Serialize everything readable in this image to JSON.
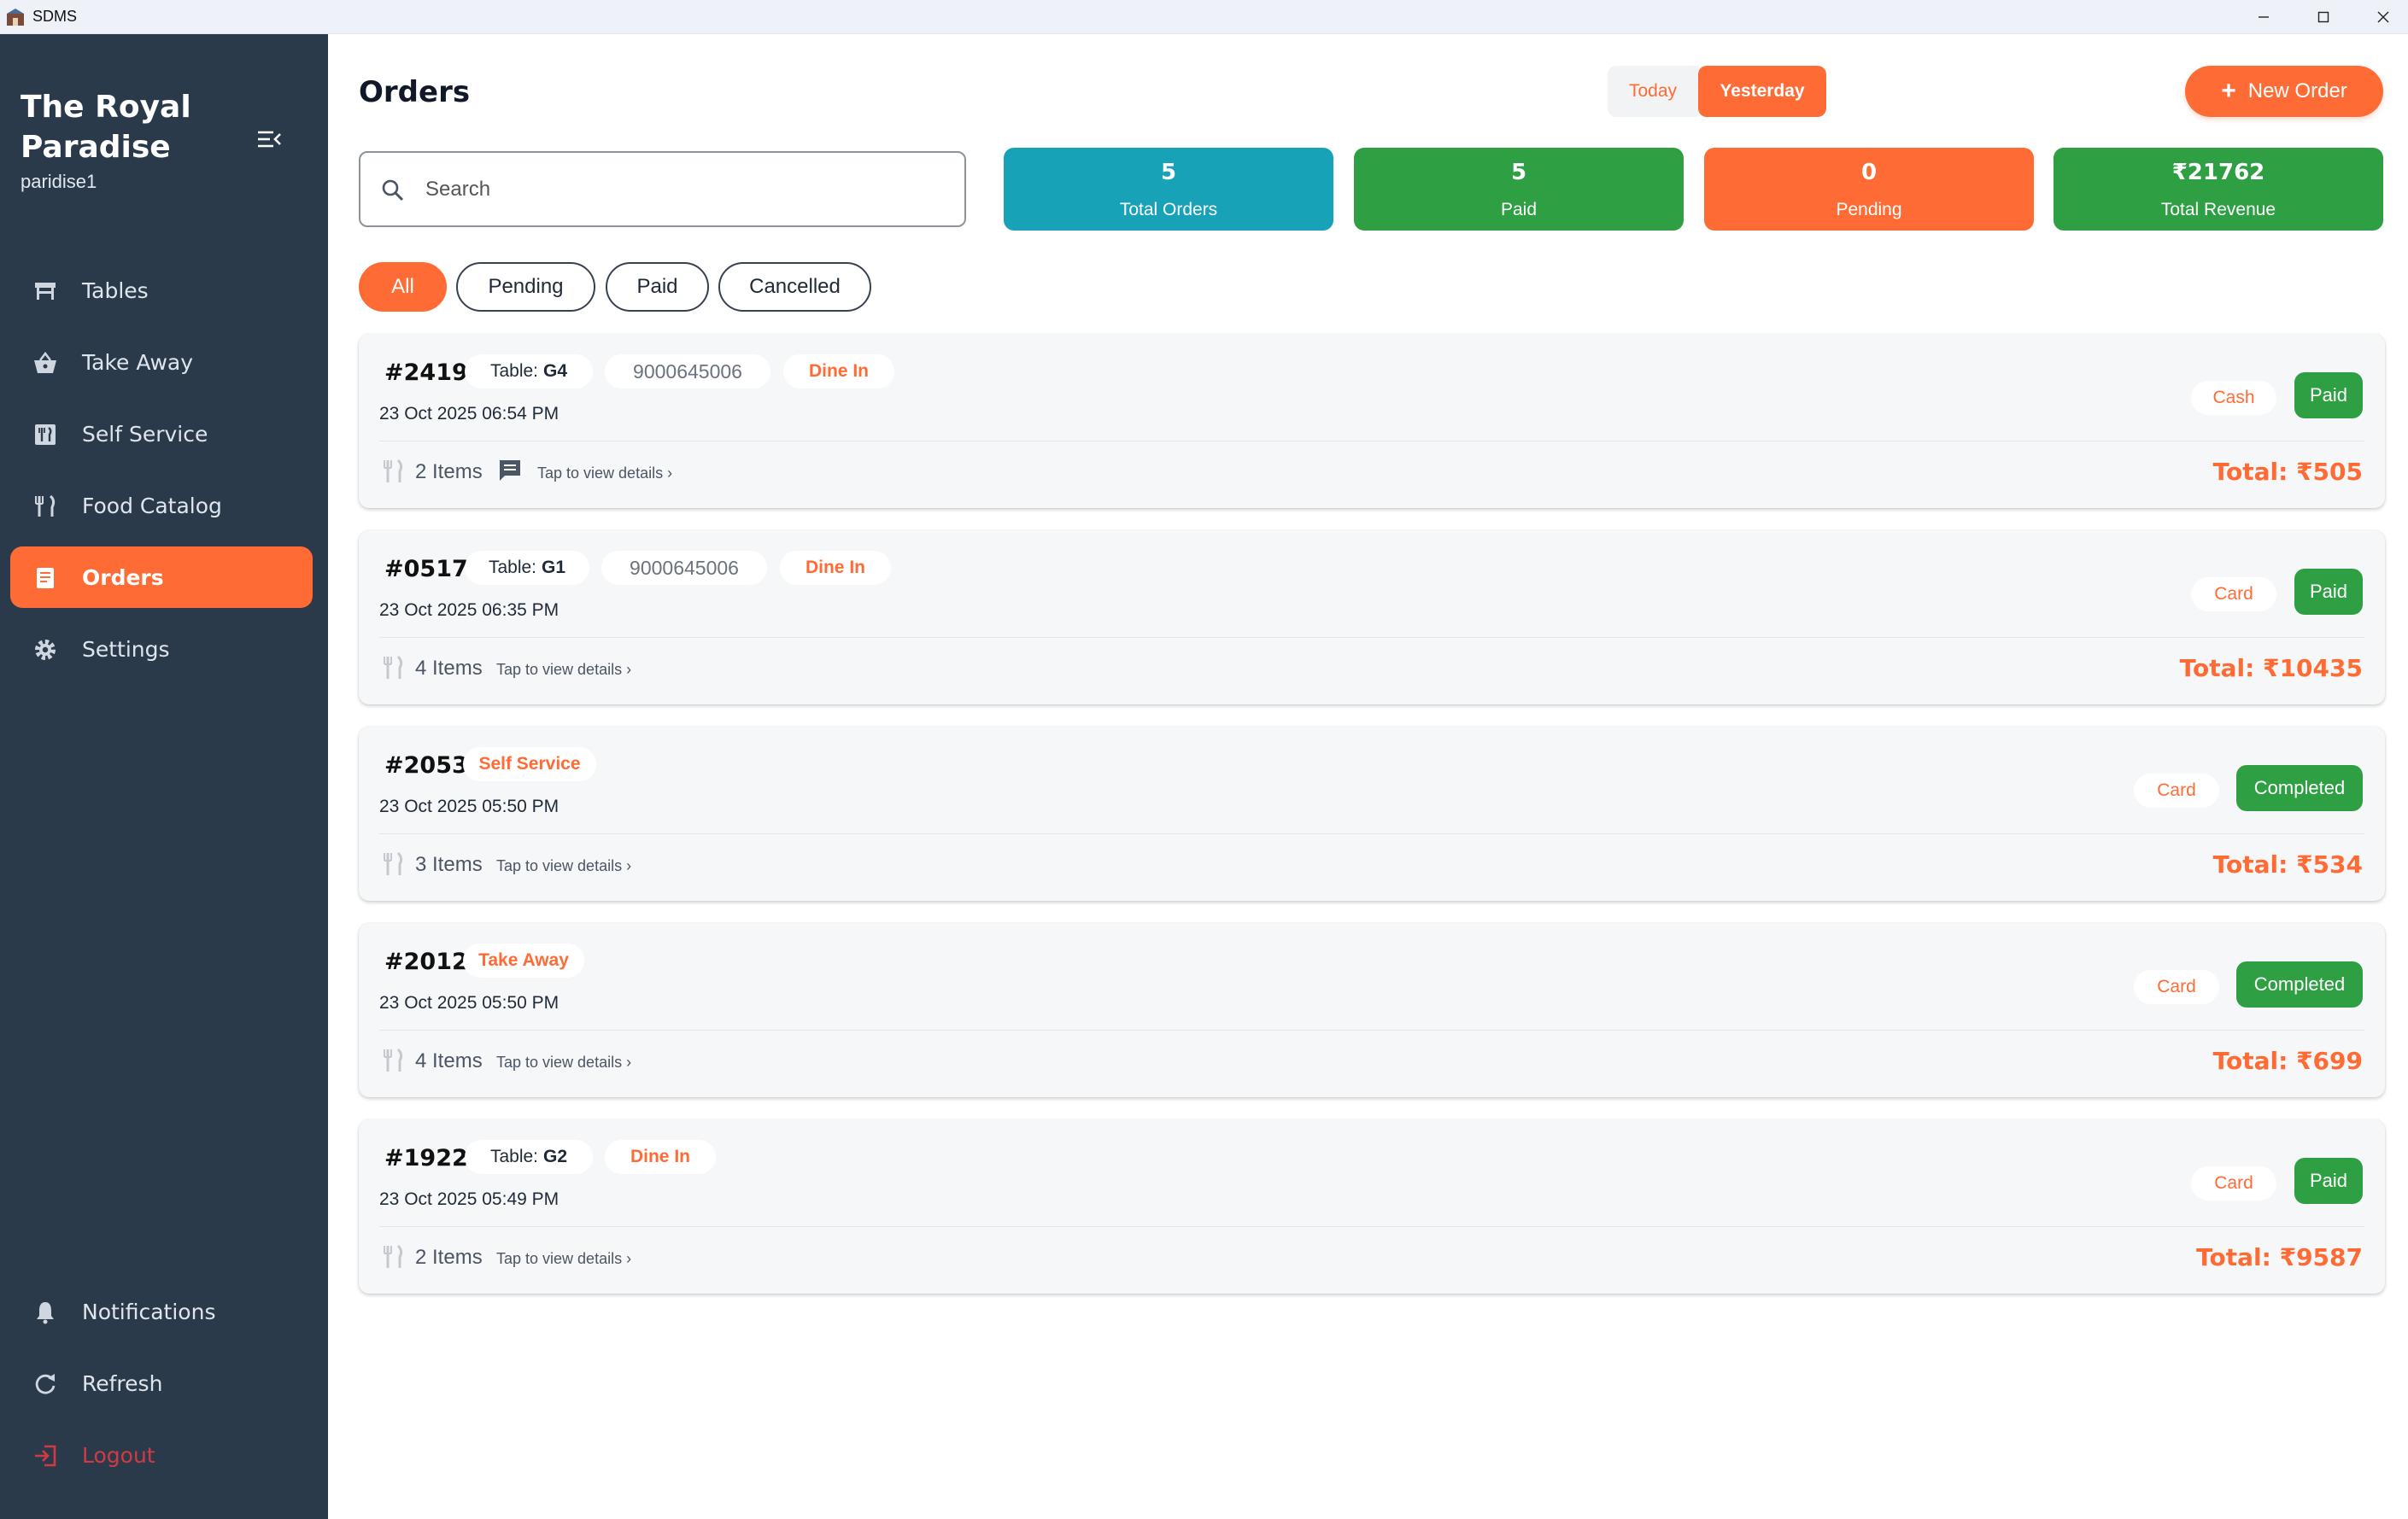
{
  "window": {
    "title": "SDMS"
  },
  "sidebar": {
    "brand": "The Royal Paradise",
    "sub": "paridise1",
    "nav": [
      {
        "label": "Tables",
        "icon": "table-icon"
      },
      {
        "label": "Take Away",
        "icon": "basket-icon"
      },
      {
        "label": "Self Service",
        "icon": "self-service-icon"
      },
      {
        "label": "Food Catalog",
        "icon": "utensils-icon"
      },
      {
        "label": "Orders",
        "icon": "receipt-icon",
        "active": true
      },
      {
        "label": "Settings",
        "icon": "gear-icon"
      }
    ],
    "bottom": [
      {
        "label": "Notifications",
        "icon": "bell-icon"
      },
      {
        "label": "Refresh",
        "icon": "refresh-icon"
      },
      {
        "label": "Logout",
        "icon": "logout-icon"
      }
    ]
  },
  "header": {
    "title": "Orders",
    "today_label": "Today",
    "yesterday_label": "Yesterday",
    "new_order_label": "New Order"
  },
  "search": {
    "placeholder": "Search",
    "value": ""
  },
  "stats": [
    {
      "value": "5",
      "label": "Total Orders",
      "color": "#17a2b8"
    },
    {
      "value": "5",
      "label": "Paid",
      "color": "#2ea043"
    },
    {
      "value": "0",
      "label": "Pending",
      "color": "#ff6b35"
    },
    {
      "value": "₹21762",
      "label": "Total Revenue",
      "color": "#2ea043"
    }
  ],
  "filters": [
    {
      "label": "All",
      "active": true
    },
    {
      "label": "Pending"
    },
    {
      "label": "Paid"
    },
    {
      "label": "Cancelled"
    }
  ],
  "orders": [
    {
      "id": "#2419",
      "table_label": "Table:",
      "table": "G4",
      "phone": "9000645006",
      "type": "Dine In",
      "date": "23 Oct 2025 06:54 PM",
      "items": "2 Items",
      "has_note": true,
      "hint": "Tap to view details",
      "payment": "Cash",
      "status": "Paid",
      "total": "Total: ₹505"
    },
    {
      "id": "#0517",
      "table_label": "Table:",
      "table": "G1",
      "phone": "9000645006",
      "type": "Dine In",
      "date": "23 Oct 2025 06:35 PM",
      "items": "4 Items",
      "has_note": false,
      "hint": "Tap to view details",
      "payment": "Card",
      "status": "Paid",
      "total": "Total: ₹10435"
    },
    {
      "id": "#2053",
      "type": "Self Service",
      "date": "23 Oct 2025 05:50 PM",
      "items": "3 Items",
      "has_note": false,
      "hint": "Tap to view details",
      "payment": "Card",
      "status": "Completed",
      "total": "Total: ₹534"
    },
    {
      "id": "#2012",
      "type": "Take Away",
      "date": "23 Oct 2025 05:50 PM",
      "items": "4 Items",
      "has_note": false,
      "hint": "Tap to view details",
      "payment": "Card",
      "status": "Completed",
      "total": "Total: ₹699"
    },
    {
      "id": "#1922",
      "table_label": "Table:",
      "table": "G2",
      "type": "Dine In",
      "date": "23 Oct 2025 05:49 PM",
      "items": "2 Items",
      "has_note": false,
      "hint": "Tap to view details",
      "payment": "Card",
      "status": "Paid",
      "total": "Total: ₹9587"
    }
  ]
}
